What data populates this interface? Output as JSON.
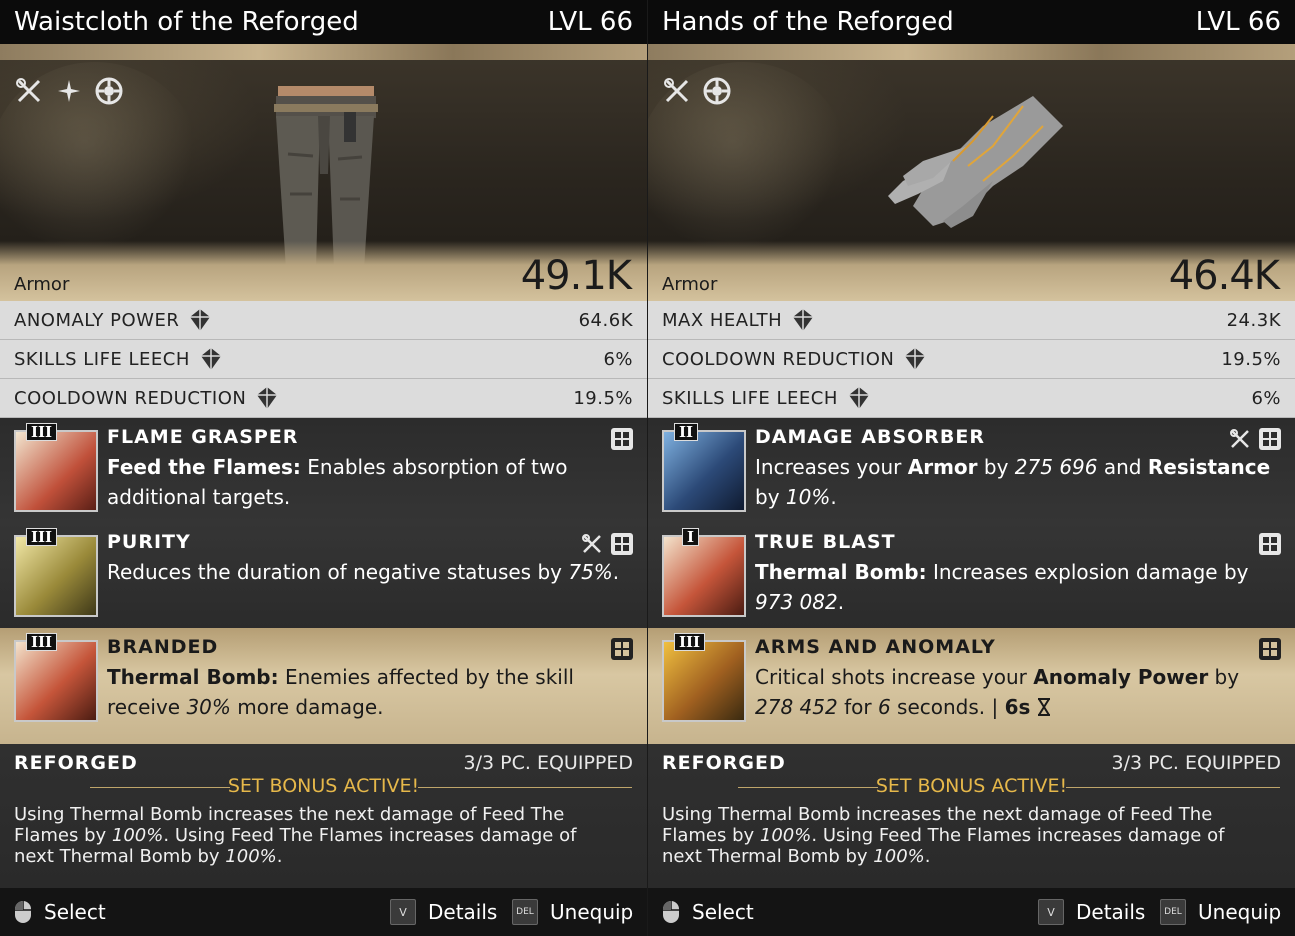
{
  "cards": [
    {
      "name": "Waistcloth of the Reforged",
      "level": "LVL 66",
      "type_label": "Armor",
      "armor_value": "49.1K",
      "item_icons": [
        "crafting-icon",
        "sparkle-icon",
        "anomaly-target-icon"
      ],
      "stats": [
        {
          "label": "ANOMALY POWER",
          "value": "64.6K"
        },
        {
          "label": "SKILLS LIFE LEECH",
          "value": "6%"
        },
        {
          "label": "COOLDOWN REDUCTION",
          "value": "19.5%"
        }
      ],
      "perks": [
        {
          "tier": "III",
          "name": "FLAME GRASPER",
          "desc_parts": {
            "bold": "Feed the Flames:",
            "text": " Enables absorption of two additional targets."
          },
          "tags": [
            "grid-icon"
          ]
        },
        {
          "tier": "III",
          "name": "PURITY",
          "desc_parts": {
            "text": "Reduces the duration of negative statuses by ",
            "italic": "75%",
            "end": "."
          },
          "tags": [
            "crafting-icon",
            "grid-icon"
          ]
        },
        {
          "tier": "III",
          "name": "BRANDED",
          "desc_parts": {
            "bold": "Thermal Bomb:",
            "text": " Enemies affected by the skill receive ",
            "italic": "30%",
            "end": " more damage."
          },
          "tags": [
            "grid-icon"
          ]
        }
      ],
      "set": {
        "name": "REFORGED",
        "equipped": "3/3 PC. EQUIPPED",
        "active": "SET BONUS ACTIVE!",
        "desc_a": "Using Thermal Bomb increases the next damage of Feed The Flames by ",
        "pct1": "100%",
        "desc_b": ". Using Feed The Flames increases damage of next Thermal Bomb by ",
        "pct2": "100%",
        "desc_c": "."
      },
      "footer": {
        "select": "Select",
        "details_key": "V",
        "details": "Details",
        "unequip_key": "DEL",
        "unequip": "Unequip"
      }
    },
    {
      "name": "Hands of the Reforged",
      "level": "LVL 66",
      "type_label": "Armor",
      "armor_value": "46.4K",
      "item_icons": [
        "crafting-icon",
        "anomaly-target-icon"
      ],
      "stats": [
        {
          "label": "MAX HEALTH",
          "value": "24.3K"
        },
        {
          "label": "COOLDOWN REDUCTION",
          "value": "19.5%"
        },
        {
          "label": "SKILLS LIFE LEECH",
          "value": "6%"
        }
      ],
      "perks": [
        {
          "tier": "II",
          "name": "DAMAGE ABSORBER",
          "desc_html": "da",
          "tags": [
            "crafting-icon",
            "grid-icon"
          ]
        },
        {
          "tier": "I",
          "name": "TRUE BLAST",
          "tags": [
            "grid-icon"
          ]
        },
        {
          "tier": "III",
          "name": "ARMS AND ANOMALY",
          "tags": [
            "grid-icon"
          ]
        }
      ],
      "perk_text": {
        "da_1": "Increases your ",
        "da_2": "Armor",
        "da_3": " by ",
        "da_4": "275 696",
        "da_5": " and ",
        "da_6": "Resistance",
        "da_7": " by ",
        "da_8": "10%",
        "da_9": ".",
        "tb_1": "Thermal Bomb:",
        "tb_2": " Increases explosion damage by ",
        "tb_3": "973 082",
        "tb_4": ".",
        "aa_1": "Critical shots increase your ",
        "aa_2": "Anomaly Power",
        "aa_3": " by ",
        "aa_4": "278 452",
        "aa_5": " for ",
        "aa_6": "6",
        "aa_7": " seconds. | ",
        "aa_8": "6s"
      },
      "set": {
        "name": "REFORGED",
        "equipped": "3/3 PC. EQUIPPED",
        "active": "SET BONUS ACTIVE!",
        "desc_a": "Using Thermal Bomb increases the next damage of Feed The Flames by ",
        "pct1": "100%",
        "desc_b": ". Using Feed The Flames increases damage of next Thermal Bomb by ",
        "pct2": "100%",
        "desc_c": "."
      },
      "footer": {
        "select": "Select",
        "details_key": "V",
        "details": "Details",
        "unequip_key": "DEL",
        "unequip": "Unequip"
      }
    }
  ]
}
